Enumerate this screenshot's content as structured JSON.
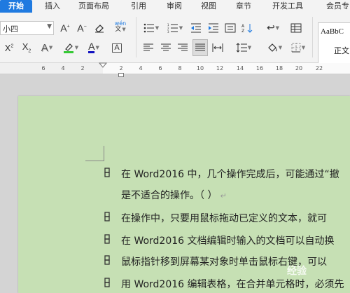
{
  "tabs": [
    {
      "label": "开始",
      "active": true
    },
    {
      "label": "插入"
    },
    {
      "label": "页面布局"
    },
    {
      "label": "引用"
    },
    {
      "label": "审阅"
    },
    {
      "label": "视图"
    },
    {
      "label": "章节"
    },
    {
      "label": "开发工具"
    },
    {
      "label": "会员专"
    }
  ],
  "ribbon": {
    "font_size_value": "小四",
    "pinyin_label": "wén",
    "styles": [
      "AaBbC",
      "正文"
    ]
  },
  "ruler": {
    "numbers": [
      "6",
      "4",
      "2",
      "2",
      "4",
      "6",
      "8",
      "10",
      "12",
      "14",
      "16",
      "18",
      "20",
      "22"
    ]
  },
  "document": {
    "lines": [
      "在 Word2016 中，几个操作完成后，可能通过“撤",
      "是不适合的操作。（      ）",
      "在操作中，只要用鼠标拖动已定义的文本，就可",
      "在 Word2016 文档编辑时输入的文档可以自动换",
      "鼠标指针移到屏幕某对象时单击鼠标右键，可以",
      "用 Word2016 编辑表格，在合并单元格时，必须先"
    ],
    "return_mark": "↵"
  },
  "watermark": "经验"
}
